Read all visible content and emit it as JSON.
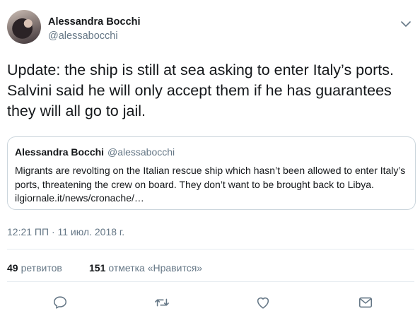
{
  "author": {
    "name": "Alessandra Bocchi",
    "handle": "@alessabocchi"
  },
  "tweet": {
    "text": "Update: the ship is still at sea asking to enter Italy’s ports. Salvini said he will only accept them if he has guarantees they will all go to jail.",
    "timestamp": "12:21 ПП · 11 июл. 2018 г."
  },
  "quoted_tweet": {
    "name": "Alessandra Bocchi",
    "handle": "@alessabocchi",
    "text": "Migrants are revolting on the Italian rescue ship which hasn’t been allowed to enter Italy’s ports, threatening the crew on board. They don’t want to be brought back to Libya. ilgiornale.it/news/cronache/…"
  },
  "stats": {
    "retweets_count": "49",
    "retweets_label": "ретвитов",
    "likes_count": "151",
    "likes_label": "отметка «Нравится»"
  },
  "icons": {
    "caret": "chevron-down-icon",
    "reply": "reply-icon",
    "retweet": "retweet-icon",
    "like": "heart-icon",
    "dm": "envelope-icon"
  },
  "colors": {
    "text": "#14171a",
    "secondary": "#657786",
    "border": "#ccd6dd",
    "divider": "#e6ecf0"
  }
}
